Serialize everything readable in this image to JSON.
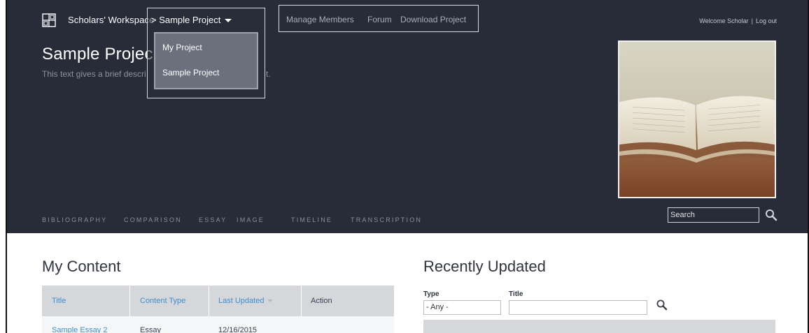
{
  "header": {
    "site_name": "Scholars' Workspace",
    "project_selector": "> Sample Project",
    "project_menu": [
      "My Project",
      "Sample Project"
    ],
    "top_nav": [
      "Manage Members",
      "Forum",
      "Download Project"
    ],
    "welcome": "Welcome Scholar",
    "logout": "Log out",
    "separator": "|"
  },
  "hero": {
    "title": "Sample Projec",
    "description": "This text gives a brief descri",
    "description_tail": "t."
  },
  "category_nav": [
    "BIBLIOGRAPHY",
    "COMPARISON",
    "ESSAY",
    "IMAGE",
    "TIMELINE",
    "TRANSCRIPTION"
  ],
  "search": {
    "placeholder": "Search"
  },
  "my_content": {
    "title": "My Content",
    "columns": [
      "Title",
      "Content Type",
      "Last Updated",
      "Action"
    ],
    "rows": [
      {
        "title": "Sample Essay 2",
        "type": "Essay",
        "updated": "12/16/2015"
      }
    ]
  },
  "recently_updated": {
    "title": "Recently Updated",
    "type_label": "Type",
    "type_value": "- Any -",
    "title_label": "Title"
  },
  "colors": {
    "header_bg": "#272c38",
    "link": "#3b8fcf",
    "table_header": "#d5d7db"
  },
  "icons": [
    "logo-icon",
    "caret-down-icon",
    "search-icon",
    "sort-arrow-icon"
  ]
}
